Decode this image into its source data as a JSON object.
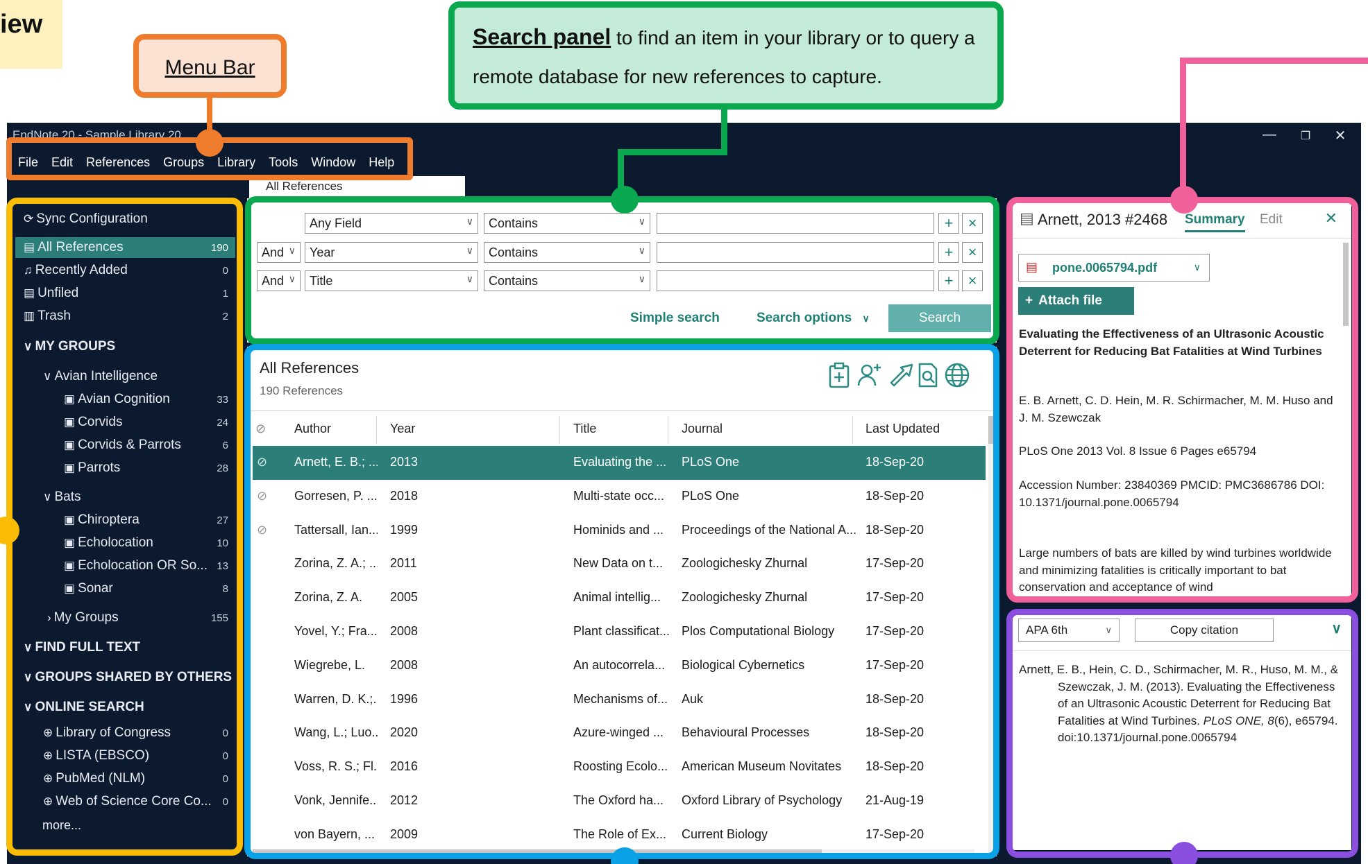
{
  "corner_label": "iew",
  "annotations": {
    "menu_bar": "Menu Bar",
    "search_panel_title": "Search panel",
    "search_panel_text_1": " to find an item in your library or to query a",
    "search_panel_text_2": "remote database for new references to capture."
  },
  "window": {
    "title": "EndNote 20 - Sample Library 20",
    "minimize": "—",
    "restore": "❐",
    "close": "✕"
  },
  "menu": [
    "File",
    "Edit",
    "References",
    "Groups",
    "Library",
    "Tools",
    "Window",
    "Help"
  ],
  "tab": "All References",
  "sidebar": {
    "sync": "Sync Configuration",
    "items": [
      {
        "label": "All References",
        "count": "190"
      },
      {
        "label": "Recently Added",
        "count": "0"
      },
      {
        "label": "Unfiled",
        "count": "1"
      },
      {
        "label": "Trash",
        "count": "2"
      }
    ],
    "my_groups": "MY GROUPS",
    "avian": "Avian Intelligence",
    "avian_items": [
      {
        "label": "Avian Cognition",
        "count": "33"
      },
      {
        "label": "Corvids",
        "count": "24"
      },
      {
        "label": "Corvids & Parrots",
        "count": "6"
      },
      {
        "label": "Parrots",
        "count": "28"
      }
    ],
    "bats": "Bats",
    "bats_items": [
      {
        "label": "Chiroptera",
        "count": "27"
      },
      {
        "label": "Echolocation",
        "count": "10"
      },
      {
        "label": "Echolocation OR So...",
        "count": "13"
      },
      {
        "label": "Sonar",
        "count": "8"
      }
    ],
    "my_groups_sub": {
      "label": "My Groups",
      "count": "155"
    },
    "find_full_text": "FIND FULL TEXT",
    "groups_shared": "GROUPS SHARED BY OTHERS",
    "online_search": "ONLINE SEARCH",
    "online_items": [
      {
        "label": "Library of Congress",
        "count": "0"
      },
      {
        "label": "LISTA (EBSCO)",
        "count": "0"
      },
      {
        "label": "PubMed (NLM)",
        "count": "0"
      },
      {
        "label": "Web of Science Core Co...",
        "count": "0"
      }
    ],
    "more": "more..."
  },
  "search": {
    "rows": [
      {
        "bool": "",
        "field": "Any Field",
        "op": "Contains",
        "value": ""
      },
      {
        "bool": "And",
        "field": "Year",
        "op": "Contains",
        "value": ""
      },
      {
        "bool": "And",
        "field": "Title",
        "op": "Contains",
        "value": ""
      }
    ],
    "simple_search": "Simple search",
    "search_options": "Search options",
    "search_button": "Search"
  },
  "list": {
    "title": "All References",
    "subtitle": "190 References",
    "columns": [
      "Author",
      "Year",
      "Title",
      "Journal",
      "Last Updated"
    ],
    "rows": [
      {
        "attach": true,
        "author": "Arnett, E. B.; ...",
        "year": "2013",
        "title": "Evaluating the ...",
        "journal": "PLoS One",
        "updated": "18-Sep-20"
      },
      {
        "attach": true,
        "author": "Gorresen, P. ...",
        "year": "2018",
        "title": "Multi-state occ...",
        "journal": "PLoS One",
        "updated": "18-Sep-20"
      },
      {
        "attach": true,
        "author": "Tattersall, Ian...",
        "year": "1999",
        "title": "Hominids and ...",
        "journal": "Proceedings of the National A...",
        "updated": "18-Sep-20"
      },
      {
        "attach": false,
        "author": "Zorina, Z. A.; ...",
        "year": "2011",
        "title": "New Data on t...",
        "journal": "Zoologichesky Zhurnal",
        "updated": "17-Sep-20"
      },
      {
        "attach": false,
        "author": "Zorina, Z. A.",
        "year": "2005",
        "title": "Animal intellig...",
        "journal": "Zoologichesky Zhurnal",
        "updated": "17-Sep-20"
      },
      {
        "attach": false,
        "author": "Yovel, Y.; Fra...",
        "year": "2008",
        "title": "Plant classificat...",
        "journal": "Plos Computational Biology",
        "updated": "17-Sep-20"
      },
      {
        "attach": false,
        "author": "Wiegrebe, L.",
        "year": "2008",
        "title": "An autocorrela...",
        "journal": "Biological Cybernetics",
        "updated": "17-Sep-20"
      },
      {
        "attach": false,
        "author": "Warren, D. K.;...",
        "year": "1996",
        "title": "Mechanisms of...",
        "journal": "Auk",
        "updated": "18-Sep-20"
      },
      {
        "attach": false,
        "author": "Wang, L.; Luo...",
        "year": "2020",
        "title": "Azure-winged ...",
        "journal": "Behavioural Processes",
        "updated": "18-Sep-20"
      },
      {
        "attach": false,
        "author": "Voss, R. S.; Fl...",
        "year": "2016",
        "title": "Roosting Ecolo...",
        "journal": "American Museum Novitates",
        "updated": "18-Sep-20"
      },
      {
        "attach": false,
        "author": "Vonk, Jennife...",
        "year": "2012",
        "title": "The Oxford ha...",
        "journal": "Oxford Library of Psychology",
        "updated": "21-Aug-19"
      },
      {
        "attach": false,
        "author": "von Bayern, ...",
        "year": "2009",
        "title": "The Role of Ex...",
        "journal": "Current Biology",
        "updated": "17-Sep-20"
      }
    ]
  },
  "summary": {
    "ref_id": "Arnett, 2013 #2468",
    "tab_summary": "Summary",
    "tab_edit": "Edit",
    "pdf": "pone.0065794.pdf",
    "attach_file": "Attach file",
    "title": "Evaluating the Effectiveness of an Ultrasonic Acoustic Deterrent for Reducing Bat Fatalities at Wind Turbines",
    "authors": "E. B. Arnett, C. D. Hein, M. R. Schirmacher, M. M. Huso and J. M. Szewczak",
    "source": "PLoS One 2013 Vol. 8 Issue 6 Pages e65794",
    "accession": "Accession Number: 23840369 PMCID: PMC3686786 DOI: 10.1371/journal.pone.0065794",
    "abstract": "Large numbers of bats are killed by wind turbines worldwide and minimizing fatalities is critically important to bat conservation and acceptance of wind"
  },
  "citation": {
    "style": "APA 6th",
    "copy": "Copy citation",
    "text_plain": "Arnett, E. B., Hein, C. D., Schirmacher, M. R., Huso, M. M., & Szewczak, J. M. (2013). Evaluating the Effectiveness of an Ultrasonic Acoustic Deterrent for Reducing Bat Fatalities at Wind Turbines. ",
    "journal_italic": "PLoS ONE, 8",
    "text_tail": "(6), e65794. doi:10.1371/journal.pone.0065794"
  },
  "colors": {
    "menu_annotation": "#ef7b2d",
    "search_annotation": "#0aa84f",
    "sidebar_annotation": "#fbbc05",
    "list_annotation": "#0aa1e6",
    "summary_annotation": "#f0609a",
    "citation_annotation": "#8b4fe0",
    "teal": "#2b7f78",
    "app_dark": "#0b1a2e"
  }
}
